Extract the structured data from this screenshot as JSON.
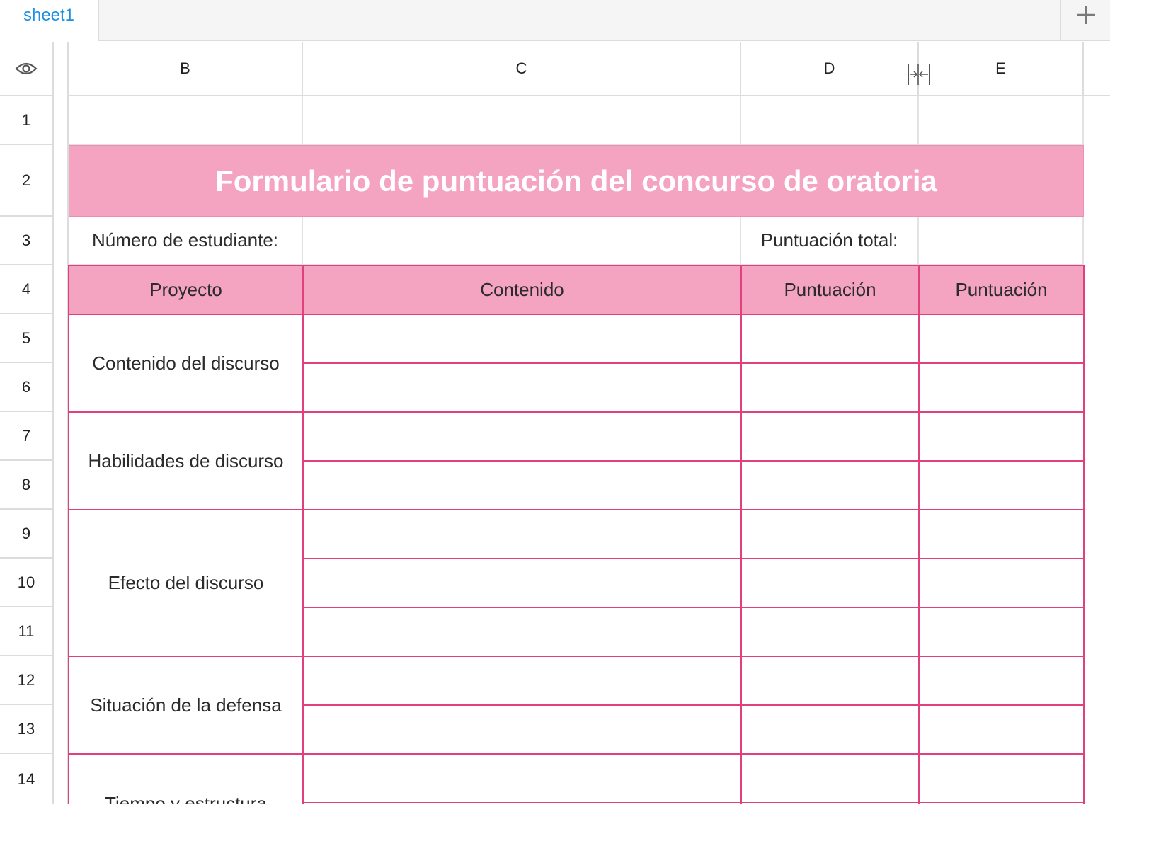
{
  "tabs": [
    {
      "label": "sheet1",
      "active": true
    }
  ],
  "columns": [
    "B",
    "C",
    "D",
    "E"
  ],
  "rows": [
    "1",
    "2",
    "3",
    "4",
    "5",
    "6",
    "7",
    "8",
    "9",
    "10",
    "11",
    "12",
    "13",
    "14"
  ],
  "sheet": {
    "title": "Formulario de puntuación del concurso de oratoria",
    "student_label": "Número de estudiante:",
    "student_value": "",
    "total_label": "Puntuación total:",
    "total_value": ""
  },
  "table": {
    "headers": [
      "Proyecto",
      "Contenido",
      "Puntuación",
      "Puntuación"
    ],
    "items": [
      {
        "label": "Contenido del discurso"
      },
      {
        "label": "Habilidades de discurso"
      },
      {
        "label": "Efecto del discurso"
      },
      {
        "label": "Situación de la defensa"
      },
      {
        "label": "Tiempo y estructura"
      }
    ]
  },
  "colors": {
    "accent_pink": "#f4a4c0",
    "border_pink": "#e0407c",
    "tab_text": "#1a8fe3",
    "title_text": "#ffffff"
  },
  "icons": {
    "visibility": "eye-icon",
    "add_sheet": "plus-icon",
    "column_resize": "column-resize-icon"
  }
}
